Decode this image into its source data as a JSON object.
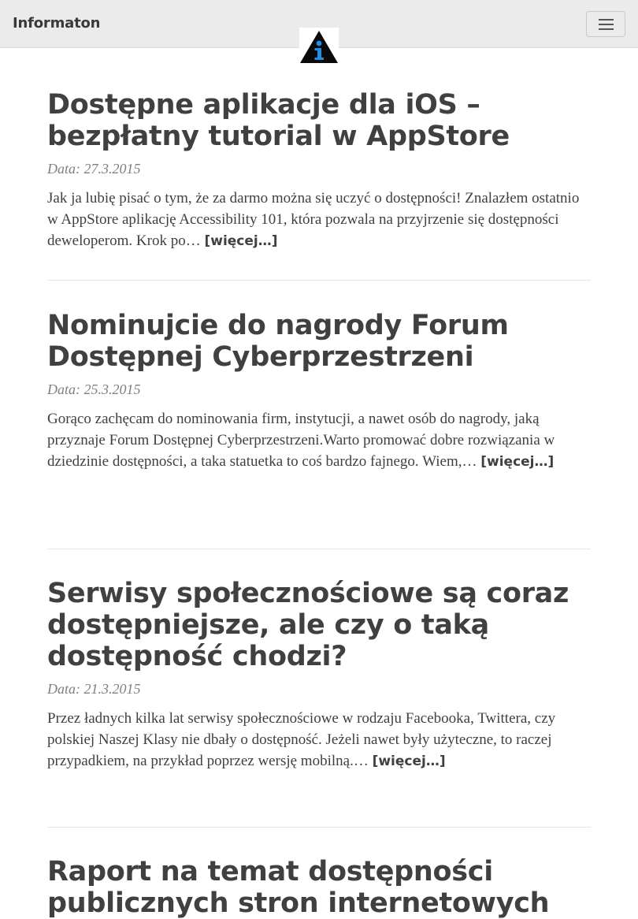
{
  "navbar": {
    "brand": "Informaton",
    "logo_icon": "info-triangle-logo",
    "toggle_icon": "hamburger-menu-icon"
  },
  "colors": {
    "navbar_bg": "#ebebeb",
    "text": "#404040",
    "meta": "#808080",
    "logo_blue": "#1e90e6"
  },
  "posts": [
    {
      "title": "Dostępne aplikacje dla iOS – bezpłatny tutorial w AppStore",
      "date": "Data: 27.3.2015",
      "excerpt": "Jak ja lubię pisać o tym, że za darmo można się uczyć o dostępności! Znalazłem ostatnio w AppStore aplikację Accessibility 101, która pozwala na przyjrzenie się dostępności deweloperom. Krok po…",
      "more": "[więcej…]"
    },
    {
      "title": "Nominujcie do nagrody Forum Dostępnej Cyberprzestrzeni",
      "date": "Data: 25.3.2015",
      "excerpt": "Gorąco zachęcam do nominowania firm, instytucji, a nawet osób do nagrody, jaką przyznaje Forum Dostępnej Cyberprzestrzeni.Warto promować dobre rozwiązania w dziedzinie dostępności, a taka statuetka to coś bardzo fajnego. Wiem,…",
      "more": "[więcej…]"
    },
    {
      "title": "Serwisy społecznościowe są coraz dostępniejsze, ale czy o taką dostępność chodzi?",
      "date": "Data: 21.3.2015",
      "excerpt": "Przez ładnych kilka lat serwisy społecznościowe w rodzaju Facebooka, Twittera, czy polskiej Naszej Klasy nie dbały o dostępność. Jeżeli nawet były użyteczne, to raczej przypadkiem, na przykład poprzez wersję mobilną.…",
      "more": "[więcej…]"
    },
    {
      "title": "Raport na temat dostępności publicznych stron internetowych"
    }
  ]
}
